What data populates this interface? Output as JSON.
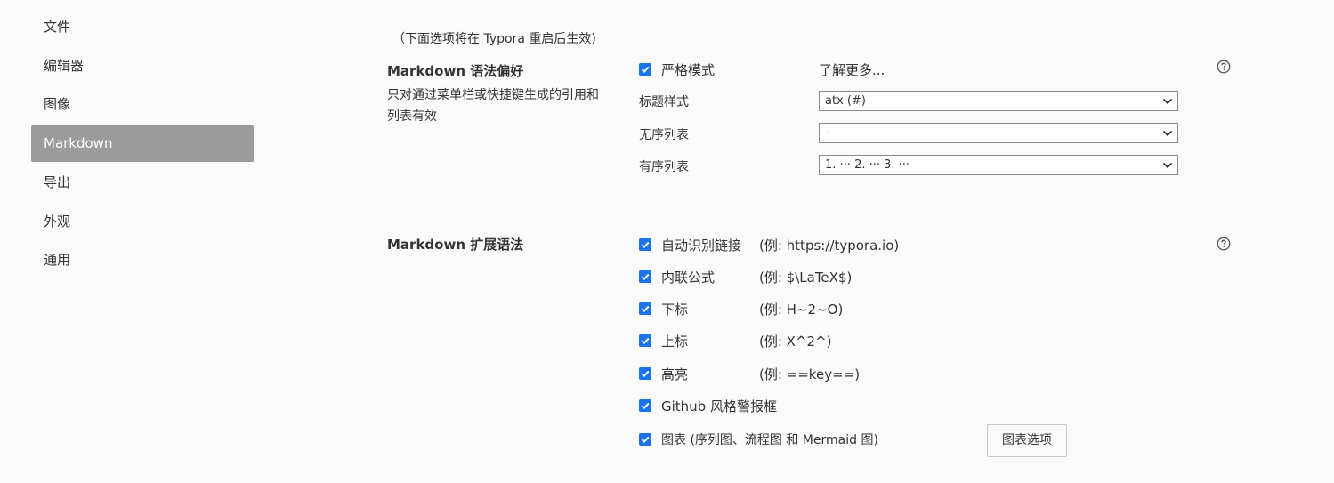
{
  "sidebar": {
    "items": [
      {
        "label": "文件",
        "active": false
      },
      {
        "label": "编辑器",
        "active": false
      },
      {
        "label": "图像",
        "active": false
      },
      {
        "label": "Markdown",
        "active": true
      },
      {
        "label": "导出",
        "active": false
      },
      {
        "label": "外观",
        "active": false
      },
      {
        "label": "通用",
        "active": false
      }
    ]
  },
  "main": {
    "note": "（下面选项将在 Typora 重启后生效)",
    "syntax": {
      "title": "Markdown 语法偏好",
      "description": "只对通过菜单栏或快捷键生成的引用和列表有效",
      "strict_mode": {
        "label": "严格模式",
        "checked": true
      },
      "learn_more": "了解更多...",
      "heading_style": {
        "label": "标题样式",
        "value": "atx (#)"
      },
      "unordered_list": {
        "label": "无序列表",
        "value": "-"
      },
      "ordered_list": {
        "label": "有序列表",
        "value": "1. ··· 2. ··· 3. ···"
      }
    },
    "extensions": {
      "title": "Markdown 扩展语法",
      "items": [
        {
          "label": "自动识别链接",
          "example": "(例: https://typora.io)",
          "checked": true
        },
        {
          "label": "内联公式",
          "example": "(例:   $\\LaTeX$)",
          "checked": true
        },
        {
          "label": "下标",
          "example": "(例:   H~2~O)",
          "checked": true
        },
        {
          "label": "上标",
          "example": "(例:   X^2^)",
          "checked": true
        },
        {
          "label": "高亮",
          "example": "(例:   ==key==)",
          "checked": true
        },
        {
          "label": "Github 风格警报框",
          "example": "",
          "checked": true
        },
        {
          "label": "图表 (序列图、流程图 和 Mermaid 图)",
          "example": "",
          "checked": true
        }
      ],
      "diagram_options_button": "图表选项"
    }
  },
  "colors": {
    "accent": "#1a73e8",
    "sidebar_active_bg": "#9b9b9b"
  }
}
